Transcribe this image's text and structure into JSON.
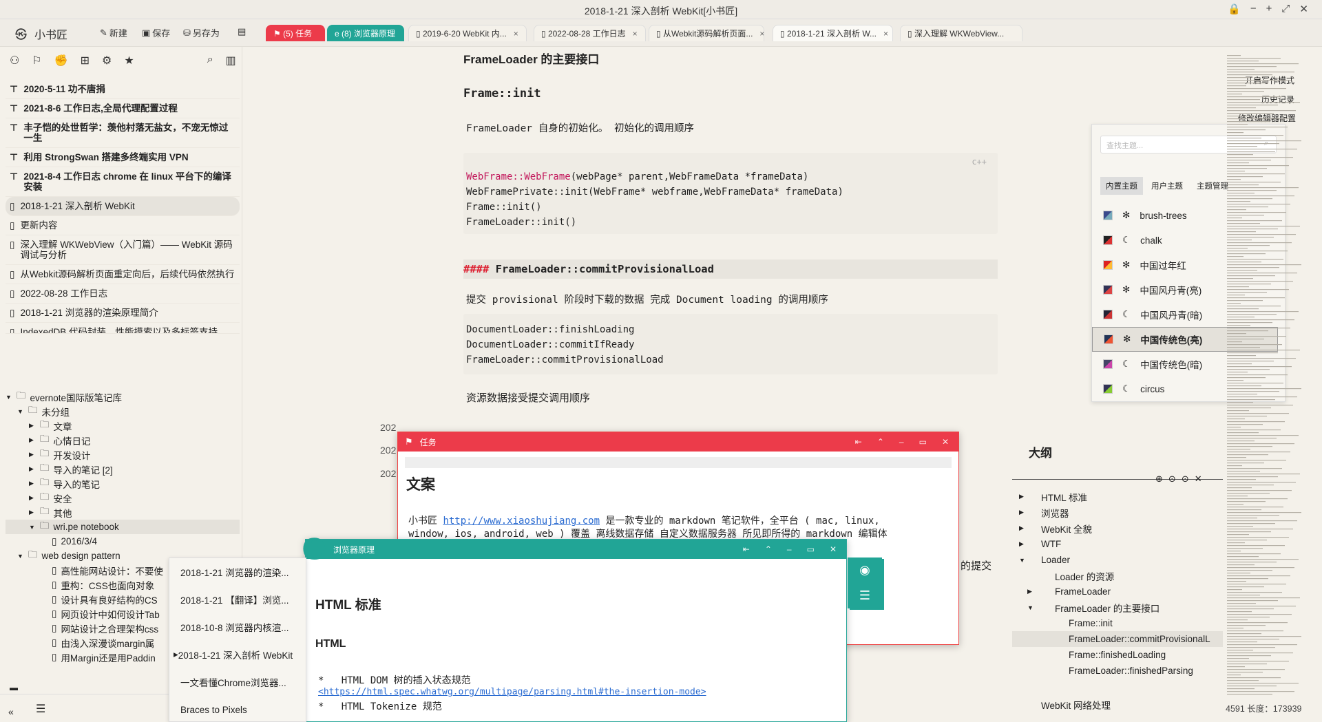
{
  "window": {
    "title": "2018-1-21 深入剖析 WebKit[小书匠]",
    "controls": [
      "🔒",
      "−",
      "+",
      "⤢",
      "✕"
    ]
  },
  "toolbar": {
    "logo": "小书匠",
    "new": "新建",
    "save": "保存",
    "save_as": "另存为"
  },
  "tabs": [
    {
      "label": "(5) 任务",
      "style": "red"
    },
    {
      "label": "(8) 浏览器原理",
      "style": "teal"
    },
    {
      "label": "2019-6-20 WebKit 内...",
      "style": "doc"
    },
    {
      "label": "2022-08-28 工作日志",
      "style": "doc"
    },
    {
      "label": "从Webkit源码解析页面...",
      "style": "doc"
    },
    {
      "label": "2018-1-21 深入剖析 W...",
      "style": "active"
    },
    {
      "label": "深入理解 WKWebView...",
      "style": "doc"
    }
  ],
  "pinned": [
    {
      "label": "2020-5-11 功不唐捐",
      "pin": true
    },
    {
      "label": "2021-8-6 工作日志,全局代理配置过程",
      "pin": true
    },
    {
      "label": "丰子恺的处世哲学：羡他村落无盐女，不宠无惊过一生",
      "pin": true
    },
    {
      "label": "利用 StrongSwan 搭建多终端实用 VPN",
      "pin": true
    },
    {
      "label": "2021-8-4 工作日志 chrome 在 linux 平台下的编译安装",
      "pin": true
    },
    {
      "label": "2018-1-21 深入剖析 WebKit",
      "pin": false,
      "selected": true
    },
    {
      "label": "更新内容",
      "pin": false
    },
    {
      "label": "深入理解 WKWebView（入门篇）—— WebKit 源码调试与分析",
      "pin": false
    },
    {
      "label": "从Webkit源码解析页面重定向后，后续代码依然执行",
      "pin": false
    },
    {
      "label": "2022-08-28 工作日志",
      "pin": false
    },
    {
      "label": "2018-1-21 浏览器的渲染原理简介",
      "pin": false
    },
    {
      "label": "IndexedDB 代码封装，性能摸索以及多标签支持",
      "pin": false
    }
  ],
  "tree": [
    {
      "label": "evernote国际版笔记库",
      "level": 0,
      "open": true,
      "type": "folder"
    },
    {
      "label": "未分组",
      "level": 1,
      "open": true,
      "type": "folder"
    },
    {
      "label": "文章",
      "level": 2,
      "type": "folder"
    },
    {
      "label": "心情日记",
      "level": 2,
      "type": "folder"
    },
    {
      "label": "开发设计",
      "level": 2,
      "type": "folder"
    },
    {
      "label": "导入的笔记 [2]",
      "level": 2,
      "type": "folder"
    },
    {
      "label": "导入的笔记",
      "level": 2,
      "type": "folder"
    },
    {
      "label": "安全",
      "level": 2,
      "type": "folder"
    },
    {
      "label": "其他",
      "level": 2,
      "type": "folder"
    },
    {
      "label": "wri.pe notebook",
      "level": 2,
      "open": true,
      "type": "folder",
      "selected": true
    },
    {
      "label": "2016/3/4",
      "level": 3,
      "type": "note"
    },
    {
      "label": "web design pattern",
      "level": 1,
      "open": true,
      "type": "folder"
    },
    {
      "label": "高性能网站设计：不要使",
      "level": 3,
      "type": "note"
    },
    {
      "label": "重构：CSS也面向对象",
      "level": 3,
      "type": "note"
    },
    {
      "label": "设计具有良好结构的CS",
      "level": 3,
      "type": "note"
    },
    {
      "label": "网页设计中如何设计Tab",
      "level": 3,
      "type": "note"
    },
    {
      "label": "网站设计之合理架构css",
      "level": 3,
      "type": "note"
    },
    {
      "label": "由浅入深漫谈margin属",
      "level": 3,
      "type": "note"
    },
    {
      "label": "用Margin还是用Paddin",
      "level": 3,
      "type": "note"
    }
  ],
  "editor": {
    "h_interfaces": "FrameLoader 的主要接口",
    "h_init": "Frame::init",
    "p_init": "FrameLoader 自身的初始化。 初始化的调用顺序",
    "code1": [
      "WebFrame::WebFrame(webPage* parent,WebFrameData *frameData)",
      "WebFramePrivate::init(WebFrame* webframe,WebFrameData* frameData)",
      "Frame::init()",
      "FrameLoader::init()"
    ],
    "code1_fn": "WebFrame::WebFrame",
    "code1_rest": "(webPage* parent,WebFrameData *frameData)",
    "lang": "c++",
    "h_commit_marker": "####",
    "h_commit": "FrameLoader::commitProvisionalLoad",
    "p_commit": "提交 provisional 阶段时下载的数据 完成 Document loading 的调用顺序",
    "code2": [
      "DocumentLoader::finishLoading",
      "DocumentLoader::commitIfReady",
      "FrameLoader::commitProvisionalLoad"
    ],
    "p_data": "资源数据接受提交调用顺序",
    "partial1": "202",
    "partial2": "202",
    "partial3": "202",
    "tail": "的提交"
  },
  "right_menu": {
    "writing_mode": "开启写作模式",
    "history": "历史记录",
    "editor_config": "修改编辑器配置"
  },
  "theme_panel": {
    "search_placeholder": "查找主题...",
    "tabs": [
      "内置主题",
      "用户主题",
      "主题管理"
    ],
    "themes": [
      {
        "name": "brush-trees",
        "mode": "light"
      },
      {
        "name": "chalk",
        "mode": "dark"
      },
      {
        "name": "中国过年红",
        "mode": "light"
      },
      {
        "name": "中国风丹青(亮)",
        "mode": "light"
      },
      {
        "name": "中国风丹青(暗)",
        "mode": "dark"
      },
      {
        "name": "中国传统色(亮)",
        "mode": "light",
        "selected": true
      },
      {
        "name": "中国传统色(暗)",
        "mode": "dark"
      },
      {
        "name": "circus",
        "mode": "dark"
      }
    ]
  },
  "outline": {
    "title": "大纲",
    "items": [
      {
        "label": "HTML 标准",
        "level": 0,
        "caret": "right"
      },
      {
        "label": "浏览器",
        "level": 0,
        "caret": "right"
      },
      {
        "label": "WebKit 全貌",
        "level": 0,
        "caret": "right"
      },
      {
        "label": "WTF",
        "level": 0,
        "caret": "right"
      },
      {
        "label": "Loader",
        "level": 0,
        "caret": "down"
      },
      {
        "label": "Loader 的资源",
        "level": 1,
        "caret": ""
      },
      {
        "label": "FrameLoader",
        "level": 1,
        "caret": "right"
      },
      {
        "label": "FrameLoader 的主要接口",
        "level": 1,
        "caret": "down"
      },
      {
        "label": "Frame::init",
        "level": 2,
        "caret": ""
      },
      {
        "label": "FrameLoader::commitProvisionalL",
        "level": 2,
        "caret": "",
        "selected": true
      },
      {
        "label": "Frame::finishedLoading",
        "level": 2,
        "caret": ""
      },
      {
        "label": "FrameLoader::finishedParsing",
        "level": 2,
        "caret": ""
      },
      {
        "label": "WebKit 网络处理",
        "level": 0,
        "caret": ""
      }
    ]
  },
  "status": {
    "text": "4591 长度：173939"
  },
  "task_window": {
    "title": "任务",
    "heading": "文案",
    "body_pre": "小书匠 ",
    "link": "http://www.xiaoshujiang.com",
    "body_post": " 是一款专业的 markdown 笔记软件，全平台 ( mac, linux,",
    "line2": "window, ios, android, web ) 覆盖 离线数据存储 自定义数据服务器 所见即所得的 markdown 编辑体"
  },
  "browser_window": {
    "title": "浏览器原理",
    "h1": "HTML 标准",
    "h2": "HTML",
    "li1": "HTML DOM 树的插入状态规范",
    "li1_link": "<https://html.spec.whatwg.org/multipage/parsing.html#the-insertion-mode>",
    "li2": "HTML Tokenize 规范"
  },
  "popup": [
    {
      "label": "2018-1-21 浏览器的渲染..."
    },
    {
      "label": "2018-1-21 【翻译】浏览..."
    },
    {
      "label": "2018-10-8 浏览器内核渲..."
    },
    {
      "label": "2018-1-21 深入剖析 WebKit",
      "selected": true
    },
    {
      "label": "一文看懂Chrome浏览器..."
    },
    {
      "label": "Braces to Pixels"
    }
  ]
}
